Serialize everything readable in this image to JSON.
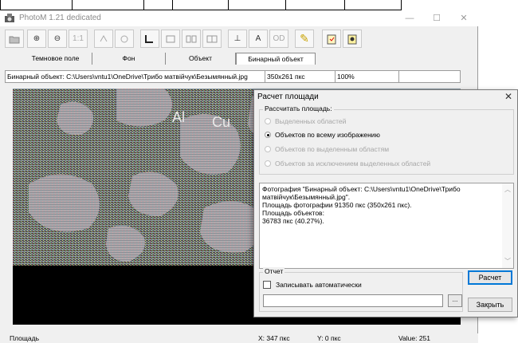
{
  "window": {
    "title": "PhotoM 1.21 dedicated",
    "controls": {
      "minimize": "—",
      "maximize": "☐",
      "close": "✕"
    }
  },
  "toolbar": {
    "buttons": [
      {
        "name": "open",
        "label": ""
      },
      {
        "name": "zoom-in",
        "label": "⊕"
      },
      {
        "name": "zoom-out",
        "label": "⊖"
      },
      {
        "name": "actual-size",
        "label": "1:1"
      },
      {
        "name": "tool-a",
        "label": ""
      },
      {
        "name": "tool-b",
        "label": ""
      },
      {
        "name": "tool-c",
        "label": ""
      },
      {
        "name": "tool-d",
        "label": ""
      },
      {
        "name": "tool-e",
        "label": ""
      },
      {
        "name": "tool-f",
        "label": ""
      },
      {
        "name": "measure-line",
        "label": "⊥"
      },
      {
        "name": "text",
        "label": "A"
      },
      {
        "name": "od",
        "label": "OD"
      },
      {
        "name": "pencil",
        "label": "✎"
      },
      {
        "name": "tool-g",
        "label": ""
      },
      {
        "name": "tool-h",
        "label": ""
      }
    ]
  },
  "tabs": [
    "Темновое поле",
    "Фон",
    "Объект",
    "Бинарный объект"
  ],
  "infobar": {
    "path": "Бинарный объект: C:\\Users\\vntu1\\OneDrive\\Трибо матвійчук\\Безымянный.jpg",
    "size": "350x261 пкс",
    "zoom": "100%"
  },
  "image_labels": {
    "a": "Al",
    "b": "Cu"
  },
  "status": {
    "mode": "Площадь",
    "x": "X: 347 пкс",
    "y": "Y: 0 пкс",
    "value": "Value: 251"
  },
  "dialog": {
    "title": "Расчет площади",
    "close": "✕",
    "area_group_label": "Рассчитать площадь:",
    "options": [
      {
        "label": "Выделенных областей",
        "selected": false,
        "enabled": false
      },
      {
        "label": "Объектов по всему изображению",
        "selected": true,
        "enabled": true
      },
      {
        "label": "Объектов по выделенным областям",
        "selected": false,
        "enabled": false
      },
      {
        "label": "Объектов за исключением выделенных областей",
        "selected": false,
        "enabled": false
      }
    ],
    "result_text": "Фотография \"Бинарный объект: C:\\Users\\vntu1\\OneDrive\\Трибо\nматвійчук\\Безымянный.jpg\".\nПлощадь фотографии 91350 пкс (350x261 пкс).\nПлощадь объектов:\n36783 пкс (40.27%).",
    "report_group_label": "Отчет",
    "auto_write_label": "Записывать автоматически",
    "report_path_value": "",
    "browse_label": "...",
    "calc_button": "Расчет",
    "close_button": "Закрыть"
  }
}
